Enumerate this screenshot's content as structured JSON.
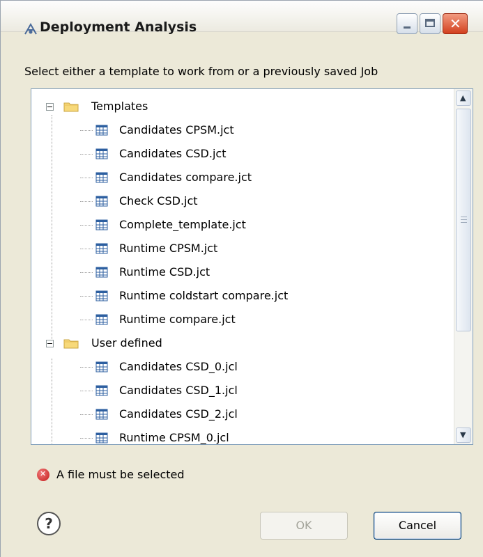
{
  "window": {
    "title": "Deployment Analysis",
    "icon": "deployment-icon",
    "controls": {
      "minimize": "minimize-icon",
      "maximize": "maximize-icon",
      "close": "close-icon"
    }
  },
  "instruction": "Select either a template to work from or a previously saved Job",
  "tree": {
    "folders": [
      {
        "label": "Templates",
        "expanded": true,
        "items": [
          "Candidates CPSM.jct",
          "Candidates CSD.jct",
          "Candidates compare.jct",
          "Check CSD.jct",
          "Complete_template.jct",
          "Runtime CPSM.jct",
          "Runtime CSD.jct",
          "Runtime coldstart compare.jct",
          "Runtime compare.jct"
        ]
      },
      {
        "label": "User defined",
        "expanded": true,
        "items": [
          "Candidates CSD_0.jcl",
          "Candidates CSD_1.jcl",
          "Candidates CSD_2.jcl",
          "Runtime CPSM_0.jcl"
        ]
      }
    ]
  },
  "status": {
    "message": "A file must be selected",
    "icon": "error-icon"
  },
  "buttons": {
    "ok": "OK",
    "cancel": "Cancel",
    "ok_enabled": false
  },
  "colors": {
    "background": "#ECE9D8",
    "close_button": "#D2401E",
    "disabled_text": "#A3A39A"
  }
}
